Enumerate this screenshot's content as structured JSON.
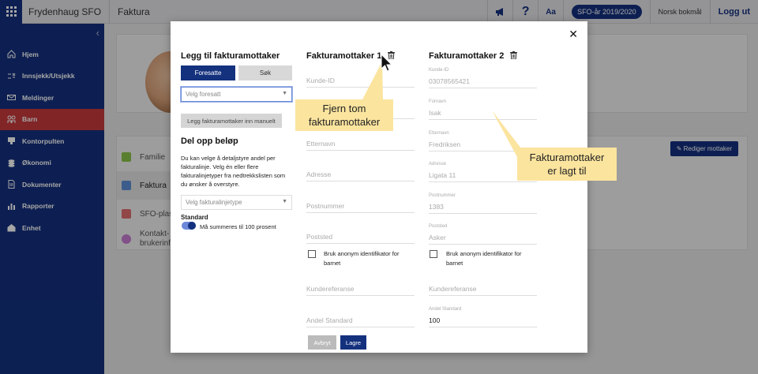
{
  "topbar": {
    "app_name": "Frydenhaug SFO",
    "module": "Faktura",
    "aa": "Aa",
    "help": "?",
    "school_year": "SFO-år 2019/2020",
    "language": "Norsk bokmål",
    "logout": "Logg ut"
  },
  "sidebar": {
    "items": [
      {
        "label": "Hjem",
        "icon": "home-icon"
      },
      {
        "label": "Innsjekk/Utsjekk",
        "icon": "checkin-icon"
      },
      {
        "label": "Meldinger",
        "icon": "mail-icon"
      },
      {
        "label": "Barn",
        "icon": "children-icon"
      },
      {
        "label": "Kontorpulten",
        "icon": "desk-icon"
      },
      {
        "label": "Økonomi",
        "icon": "economy-icon"
      },
      {
        "label": "Dokumenter",
        "icon": "document-icon"
      },
      {
        "label": "Rapporter",
        "icon": "report-icon"
      },
      {
        "label": "Enhet",
        "icon": "unit-icon"
      }
    ],
    "active_index": 3
  },
  "background": {
    "list": [
      "Familie",
      "Faktura",
      "SFO-plas",
      "Kontakt- brukerinf"
    ],
    "edit_button": "Rediger mottaker"
  },
  "modal": {
    "left": {
      "title": "Legg til fakturamottaker",
      "tab_parents": "Foresatte",
      "tab_search": "Søk",
      "select_parent_placeholder": "Velg foresatt",
      "manual_button": "Legg fakturamottaker inn manuelt",
      "split_title": "Del opp beløp",
      "split_text": "Du kan velge å detaljstyre andel per fakturalinje. Velg én eller flere fakturalinjetyper fra nedtrekkslisten som du ønsker å overstyre.",
      "line_type_placeholder": "Velg fakturalinjetype",
      "standard_label": "Standard",
      "toggle_text": "Må summeres til 100 prosent"
    },
    "receiver1": {
      "title": "Fakturamottaker 1",
      "customer_id": "Kunde-ID",
      "last_name": "Etternavn",
      "address": "Adresse",
      "postal_code": "Postnummer",
      "postal_place": "Poststed",
      "anon_text": "Bruk anonym identifikator for barnet",
      "customer_ref": "Kundereferanse",
      "share_standard": "Andel Standard"
    },
    "receiver2": {
      "title": "Fakturamottaker 2",
      "customer_id_label": "Kunde-ID",
      "customer_id_value": "03078565421",
      "first_name_label": "Fornavn",
      "first_name_value": "Isak",
      "last_name_label": "Etternavn",
      "last_name_value": "Fredriksen",
      "address_label": "Adresse",
      "address_value": "Ligata 11",
      "postal_code_label": "Postnummer",
      "postal_code_value": "1383",
      "postal_place_label": "Poststed",
      "postal_place_value": "Asker",
      "anon_text": "Bruk anonym identifikator for barnet",
      "customer_ref": "Kundereferanse",
      "share_label": "Andel Standard",
      "share_value": "100"
    },
    "cancel": "Avbryt",
    "save": "Lagre",
    "close": "✕"
  },
  "callouts": {
    "remove_empty_line1": "Fjern tom",
    "remove_empty_line2": "fakturamottaker",
    "added_line1": "Fakturamottaker",
    "added_line2": "er lagt til",
    "color": "#fbe49e"
  },
  "colors": {
    "brand": "#14317e",
    "active_nav": "#c73a3c"
  }
}
